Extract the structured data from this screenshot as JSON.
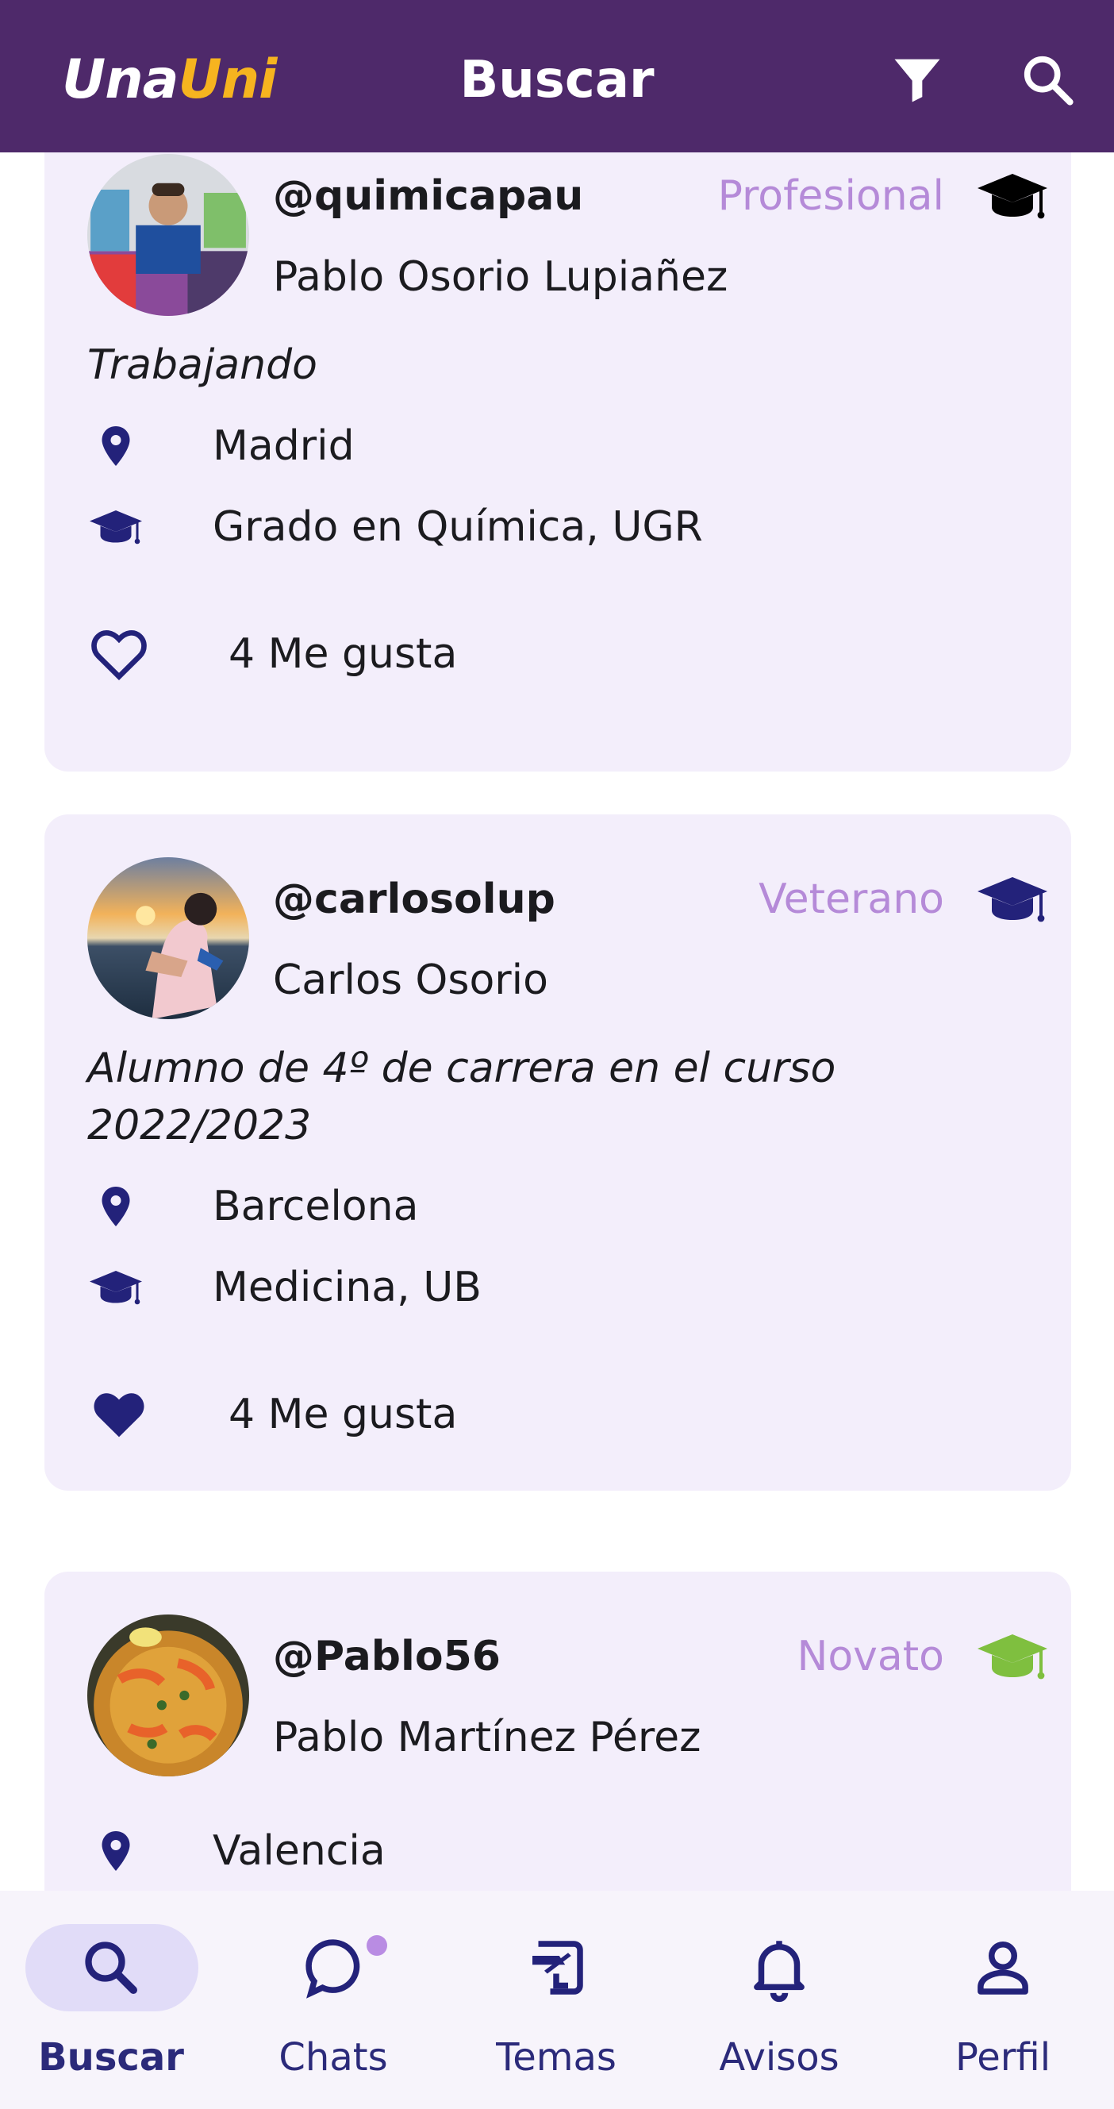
{
  "app": {
    "logo_part1": "Una",
    "logo_part2": "Uni",
    "title": "Buscar"
  },
  "header_icons": [
    "filter-icon",
    "search-icon"
  ],
  "colors": {
    "appbar": "#4e296a",
    "logo_accent": "#f6b41f",
    "card_bg": "#f3eefb",
    "level_text": "#b58ad8",
    "icon_navy": "#23227a",
    "novato_green": "#7fbf3f",
    "nav_pill": "#e1dcf8",
    "nav_dot": "#b98ce3"
  },
  "users": [
    {
      "handle": "@quimicapau",
      "name": "Pablo Osorio Lupiañez",
      "level": "Profesional",
      "level_icon_color": "#000000",
      "bio": "Trabajando",
      "location": "Madrid",
      "degree": "Grado en Química, UGR",
      "likes": "4 Me gusta",
      "liked": false
    },
    {
      "handle": "@carlosolup",
      "name": "Carlos Osorio",
      "level": "Veterano",
      "level_icon_color": "#23227a",
      "bio": "Alumno de 4º de carrera en el curso 2022/2023",
      "location": "Barcelona",
      "degree": "Medicina, UB",
      "likes": "4 Me gusta",
      "liked": true
    },
    {
      "handle": "@Pablo56",
      "name": "Pablo Martínez Pérez",
      "level": "Novato",
      "level_icon_color": "#7fbf3f",
      "location": "Valencia"
    }
  ],
  "nav": [
    {
      "label": "Buscar",
      "icon": "search-icon",
      "active": true
    },
    {
      "label": "Chats",
      "icon": "chat-bubble-icon",
      "active": false,
      "badge": true
    },
    {
      "label": "Temas",
      "icon": "topics-icon",
      "active": false
    },
    {
      "label": "Avisos",
      "icon": "bell-icon",
      "active": false
    },
    {
      "label": "Perfil",
      "icon": "person-icon",
      "active": false
    }
  ]
}
